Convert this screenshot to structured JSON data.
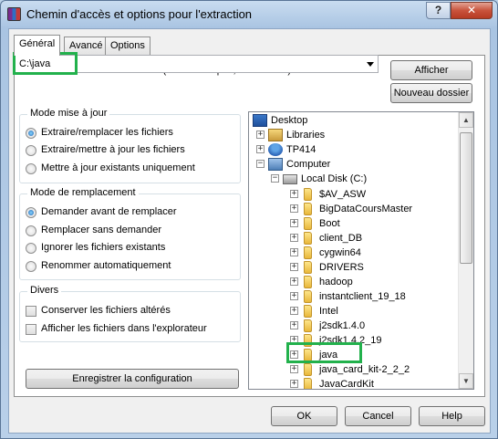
{
  "window": {
    "title": "Chemin d'accès et options pour l'extraction",
    "help_label": "?",
    "close_label": "✕"
  },
  "tabs": [
    {
      "label": "Général",
      "active": true
    },
    {
      "label": "Avancé",
      "active": false
    },
    {
      "label": "Options",
      "active": false
    }
  ],
  "destination": {
    "label": "Chemin d'accès de destination (s'il n'existe pas, il sera créé)",
    "value": "C:\\java",
    "show_button": "Afficher",
    "new_folder_button": "Nouveau dossier"
  },
  "update_mode": {
    "title": "Mode mise à jour",
    "options": [
      {
        "label": "Extraire/remplacer les fichiers",
        "checked": true
      },
      {
        "label": "Extraire/mettre à jour les fichiers",
        "checked": false
      },
      {
        "label": "Mettre à jour existants uniquement",
        "checked": false
      }
    ]
  },
  "overwrite_mode": {
    "title": "Mode de remplacement",
    "options": [
      {
        "label": "Demander avant de remplacer",
        "checked": true
      },
      {
        "label": "Remplacer sans demander",
        "checked": false
      },
      {
        "label": "Ignorer les fichiers existants",
        "checked": false
      },
      {
        "label": "Renommer automatiquement",
        "checked": false
      }
    ]
  },
  "misc": {
    "title": "Divers",
    "options": [
      {
        "label": "Conserver les fichiers altérés",
        "checked": false
      },
      {
        "label": "Afficher les fichiers dans l'explorateur",
        "checked": false
      }
    ]
  },
  "save_settings_button": "Enregistrer la configuration",
  "tree": {
    "desktop": "Desktop",
    "libraries": "Libraries",
    "user": "TP414",
    "computer": "Computer",
    "local_disk": "Local Disk (C:)",
    "folders": [
      "$AV_ASW",
      "BigDataCoursMaster",
      "Boot",
      "client_DB",
      "cygwin64",
      "DRIVERS",
      "hadoop",
      "instantclient_19_18",
      "Intel",
      "j2sdk1.4.0",
      "j2sdk1.4.2_19",
      "java",
      "java_card_kit-2_2_2",
      "JavaCardKit"
    ],
    "selected_folder": "java"
  },
  "footer": {
    "ok": "OK",
    "cancel": "Cancel",
    "help": "Help"
  },
  "colors": {
    "highlight": "#22b14c",
    "titlebar": "#bcd3ea",
    "close": "#c9533c"
  }
}
